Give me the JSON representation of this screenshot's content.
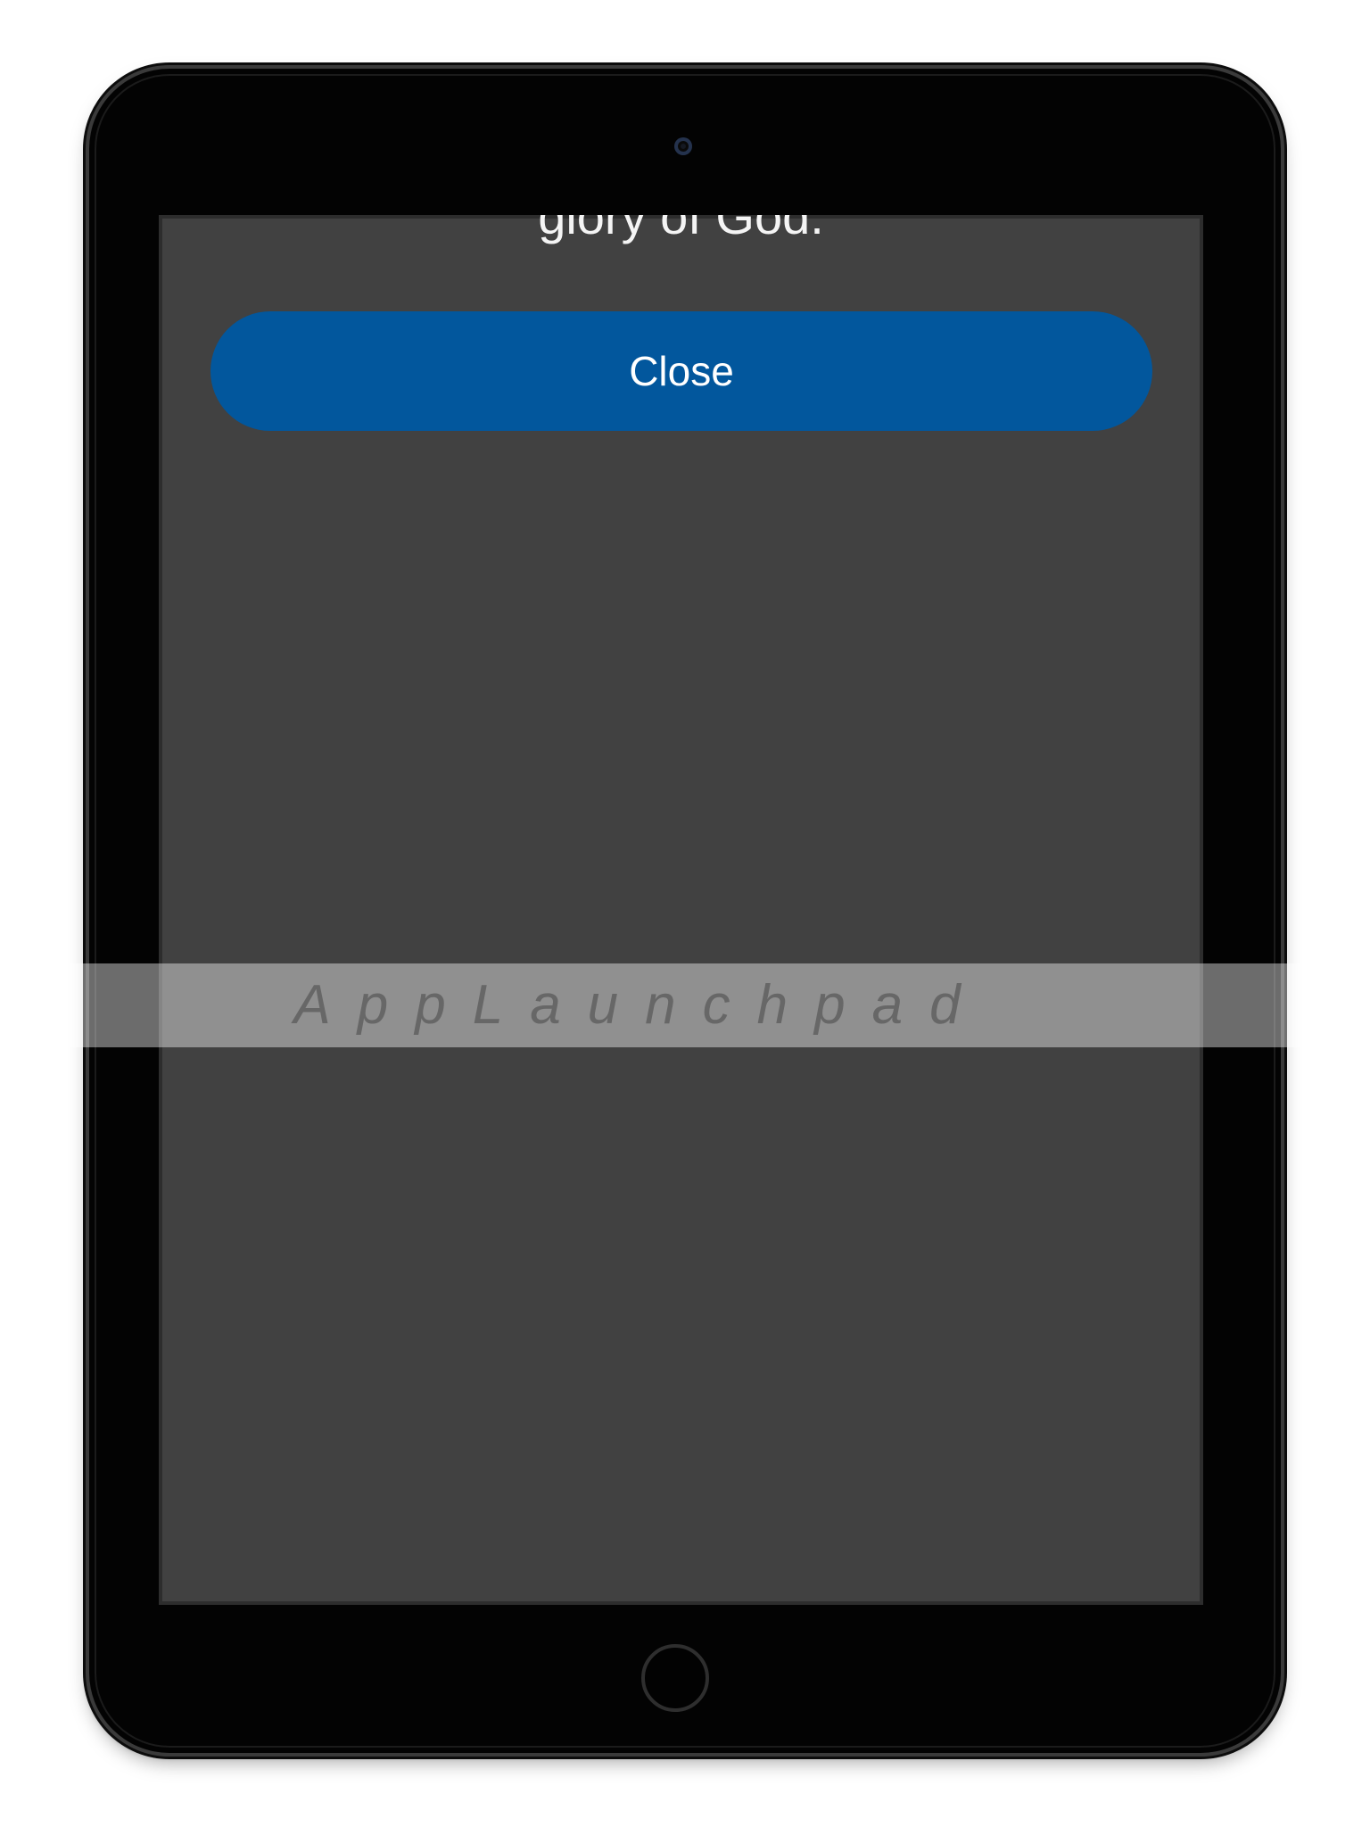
{
  "screen": {
    "body_text": "glory of God.",
    "close_label": "Close"
  },
  "watermark": {
    "text": "AppLaunchpad"
  },
  "colors": {
    "screen_background": "#414141",
    "button": "#02579d",
    "button_text": "#ffffff",
    "device_frame": "#030303"
  }
}
